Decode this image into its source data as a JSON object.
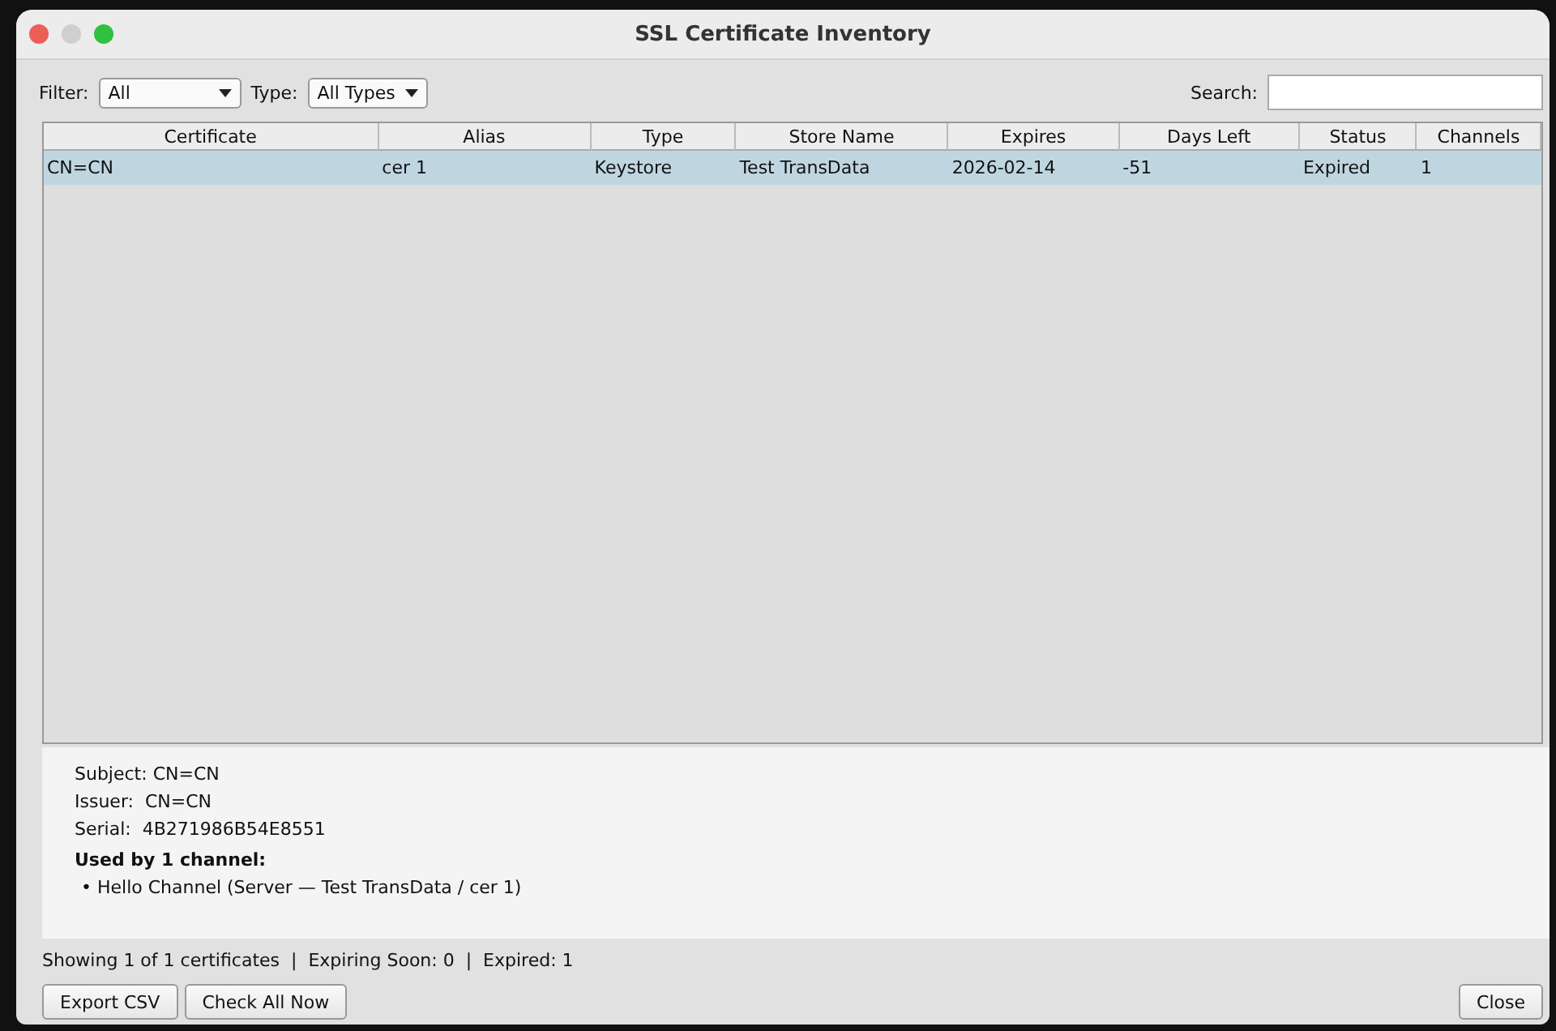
{
  "window": {
    "title": "SSL Certificate Inventory"
  },
  "filters": [
    {
      "label": "Filter:",
      "value": "All"
    },
    {
      "label": "Type:",
      "value": "All Types"
    }
  ],
  "search": {
    "label": "Search:"
  },
  "table": {
    "columns": [
      "Certificate",
      "Alias",
      "Type",
      "Store Name",
      "Expires",
      "Days Left",
      "Status",
      "Channels"
    ],
    "rows": [
      {
        "selected": true,
        "cells": [
          "CN=CN",
          "cer 1",
          "Keystore",
          "Test TransData",
          "2026-02-14",
          "-51",
          "Expired",
          "1"
        ]
      }
    ]
  },
  "details": {
    "lines": [
      "Subject: CN=CN",
      "Issuer:  CN=CN",
      "Serial:  4B271986B54E8551"
    ],
    "heading": "Used by 1 channel:",
    "items": [
      "• Hello Channel (Server — Test TransData / cer 1)"
    ]
  },
  "status_bar": "Showing 1 of 1 certificates  |  Expiring Soon: 0  |  Expired: 1",
  "buttons": {
    "left": [
      "Export CSV",
      "Check All Now"
    ],
    "right": [
      "Close"
    ]
  }
}
